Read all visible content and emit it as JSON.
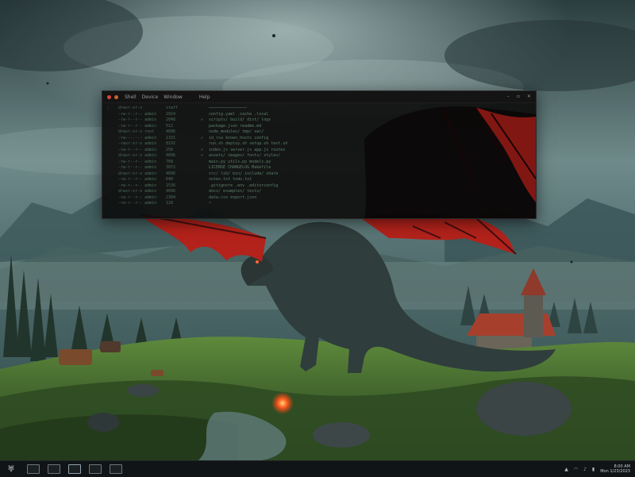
{
  "terminal": {
    "menu": [
      "Shell",
      "Device",
      "Window",
      "Help"
    ],
    "window_controls": [
      "–",
      "▫",
      "✕"
    ],
    "rows": [
      [
        "✓",
        "drwxr-xr-x  ",
        "staff  ",
        "",
        "────────────────"
      ],
      [
        "",
        "-rw-r--r--  admin",
        "1024  ",
        "",
        "config.yaml .cache .local"
      ],
      [
        "",
        "-rw-r--r--  admin",
        "2048  ",
        "✓",
        "scripts/ build/ dist/ logs"
      ],
      [
        "",
        "-rw-r--r--  admin",
        "512   ",
        "",
        "package.json readme.md"
      ],
      [
        "",
        "drwxr-xr-x  root ",
        "4096  ",
        "",
        "node_modules/ tmp/ var/"
      ],
      [
        "",
        "-rw-------  admin",
        "1331  ",
        "✓",
        "id_rsa known_hosts config"
      ],
      [
        "",
        "-rwxr-xr-x  admin",
        "8192  ",
        "",
        "run.sh deploy.sh setup.sh test.sh"
      ],
      [
        "",
        "-rw-r--r--  admin",
        "256   ",
        "✓",
        "index.js server.js app.js routes"
      ],
      [
        "",
        "drwxr-xr-x  admin",
        "4096  ",
        "✓",
        "assets/ images/ fonts/ styles/"
      ],
      [
        "",
        "-rw-r--r--  admin",
        "768   ",
        "",
        "main.py utils.py models.py"
      ],
      [
        "",
        "-rw-r--r--  admin",
        "3072  ",
        "",
        "LICENSE CHANGELOG Makefile"
      ],
      [
        "",
        "drwxr-xr-x  admin",
        "4096  ",
        "",
        "src/ lib/ bin/ include/ share"
      ],
      [
        "",
        "-rw-r--r--  admin",
        "640   ",
        "",
        "notes.txt todo.txt"
      ],
      [
        "",
        "-rw-r--r--  admin",
        "1536  ",
        "",
        ".gitignore .env .editorconfig"
      ],
      [
        "",
        "drwxr-xr-x  admin",
        "4096  ",
        "",
        "docs/ examples/ tests/"
      ],
      [
        "",
        "-rw-r--r--  admin",
        "2304  ",
        "",
        "data.csv export.json"
      ],
      [
        "",
        "-rw-r--r--  admin",
        "128   ",
        "",
        "~"
      ]
    ]
  },
  "taskbar": {
    "start_glyph": "♅",
    "apps": [
      "files",
      "browser",
      "terminal",
      "settings",
      "store"
    ],
    "tray": [
      "▲",
      "wifi",
      "vol",
      "bat"
    ],
    "time": "8:00 AM",
    "date": "Mon 1/23/2023"
  },
  "colors": {
    "terminal_bg": "#0e0e0e",
    "terminal_text": "#4d6d57",
    "wing_red": "#b3221b",
    "taskbar_bg": "#111416"
  }
}
